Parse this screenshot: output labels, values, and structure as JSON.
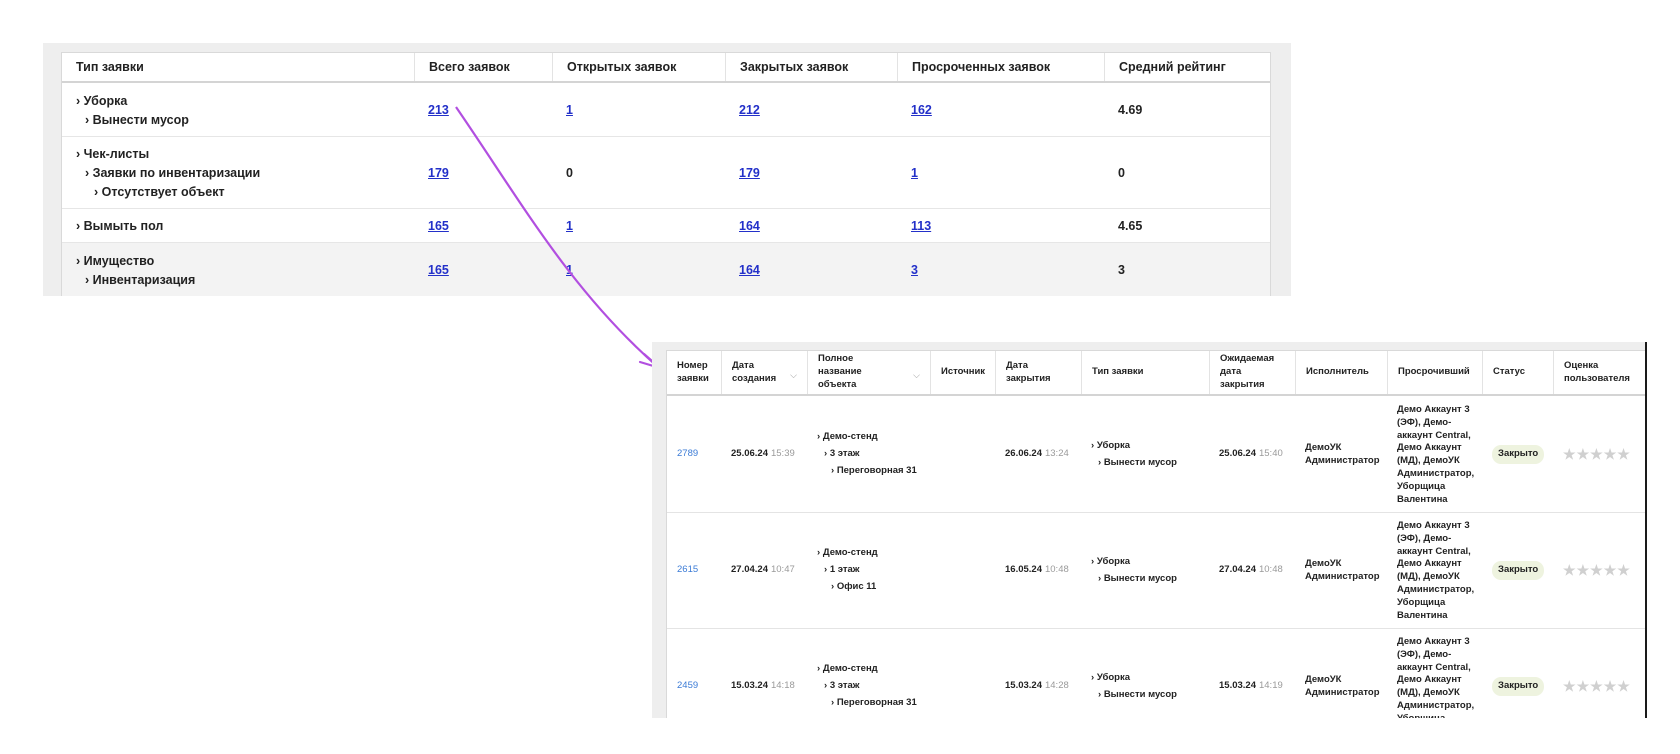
{
  "summary": {
    "headers": [
      "Тип заявки",
      "Всего заявок",
      "Открытых заявок",
      "Закрытых заявок",
      "Просроченных заявок",
      "Средний рейтинг"
    ],
    "rows": [
      {
        "type": [
          "Уборка",
          "Вынести мусор"
        ],
        "total": "213",
        "open": "1",
        "closed": "212",
        "overdue": "162",
        "rating": "4.69"
      },
      {
        "type": [
          "Чек-листы",
          "Заявки по инвентаризации",
          "Отсутствует объект"
        ],
        "total": "179",
        "open": "0",
        "closed": "179",
        "overdue": "1",
        "rating": "0"
      },
      {
        "type": [
          "Вымыть пол"
        ],
        "total": "165",
        "open": "1",
        "closed": "164",
        "overdue": "113",
        "rating": "4.65"
      },
      {
        "type": [
          "Имущество",
          "Инвентаризация"
        ],
        "total": "165",
        "open": "1",
        "closed": "164",
        "overdue": "3",
        "rating": "3"
      }
    ]
  },
  "detail": {
    "headers": [
      "Номер заявки",
      "Дата создания",
      "Полное название объекта",
      "Источник",
      "Дата закрытия",
      "Тип заявки",
      "Ожидаемая дата закрытия",
      "Исполнитель",
      "Просрочивший",
      "Статус",
      "Оценка пользователя"
    ],
    "rows": [
      {
        "number": "2789",
        "created_date": "25.06.24",
        "created_time": "15:39",
        "object": [
          "Демо-стенд",
          "3 этаж",
          "Переговорная 31"
        ],
        "source": "",
        "closed_date": "26.06.24",
        "closed_time": "13:24",
        "type": [
          "Уборка",
          "Вынести мусор"
        ],
        "expected_date": "25.06.24",
        "expected_time": "15:40",
        "executor": "ДемоУК Администратор",
        "overdue_by": "Демо Аккаунт 3 (ЭФ), Демо-аккаунт Central, Демо Аккаунт (МД), ДемоУК Администратор, Уборщица Валентина",
        "status": "Закрыто",
        "rating": 0
      },
      {
        "number": "2615",
        "created_date": "27.04.24",
        "created_time": "10:47",
        "object": [
          "Демо-стенд",
          "1 этаж",
          "Офис 11"
        ],
        "source": "",
        "closed_date": "16.05.24",
        "closed_time": "10:48",
        "type": [
          "Уборка",
          "Вынести мусор"
        ],
        "expected_date": "27.04.24",
        "expected_time": "10:48",
        "executor": "ДемоУК Администратор",
        "overdue_by": "Демо Аккаунт 3 (ЭФ), Демо-аккаунт Central, Демо Аккаунт (МД), ДемоУК Администратор, Уборщица Валентина",
        "status": "Закрыто",
        "rating": 0
      },
      {
        "number": "2459",
        "created_date": "15.03.24",
        "created_time": "14:18",
        "object": [
          "Демо-стенд",
          "3 этаж",
          "Переговорная 31"
        ],
        "source": "",
        "closed_date": "15.03.24",
        "closed_time": "14:28",
        "type": [
          "Уборка",
          "Вынести мусор"
        ],
        "expected_date": "15.03.24",
        "expected_time": "14:19",
        "executor": "ДемоУК Администратор",
        "overdue_by": "Демо Аккаунт 3 (ЭФ), Демо-аккаунт Central, Демо Аккаунт (МД), ДемоУК Администратор, Уборщица",
        "status": "Закрыто",
        "rating": 0
      }
    ]
  },
  "colors": {
    "link": "#2330c9",
    "arrow": "#b24fe0",
    "badge_bg": "#eef3df",
    "star": "#d0d0d0"
  },
  "icons": {
    "tree_marker": "chevron-right-icon",
    "sort": "chevron-down-icon",
    "rating": "star-icon"
  }
}
